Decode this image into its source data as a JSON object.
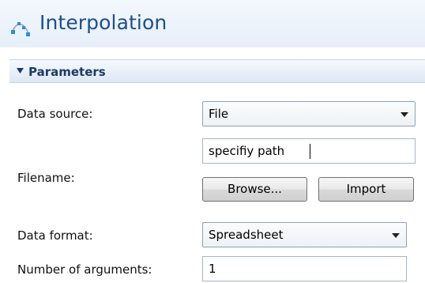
{
  "panel": {
    "title": "Interpolation",
    "icon": "interpolation-icon"
  },
  "section": {
    "title": "Parameters",
    "expanded": true
  },
  "form": {
    "data_source": {
      "label": "Data source:",
      "value": "File"
    },
    "filename": {
      "label": "Filename:",
      "value": "specifiy path",
      "browse_label": "Browse...",
      "import_label": "Import"
    },
    "data_format": {
      "label": "Data format:",
      "value": "Spreadsheet"
    },
    "num_arguments": {
      "label": "Number of arguments:",
      "value": "1"
    }
  },
  "colors": {
    "title_text": "#1f4e8f",
    "header_bg": "#dce8f6",
    "icon_accent": "#2a8fd8"
  }
}
